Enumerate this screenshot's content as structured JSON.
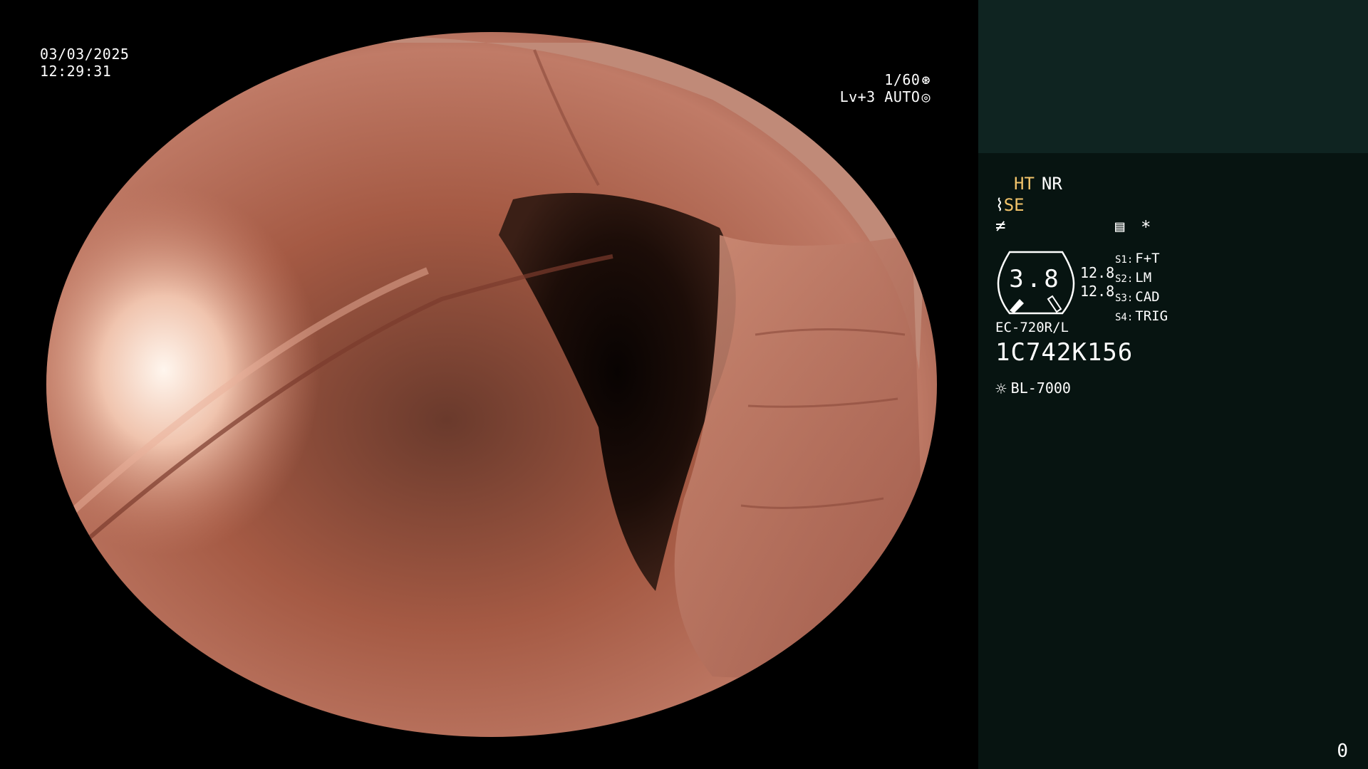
{
  "overlay": {
    "date": "03/03/2025",
    "time": "12:29:31",
    "shutter": "1/60",
    "shutter_icon": "aperture-icon",
    "level": "Lv+3",
    "mode": "AUTO",
    "mode_icon": "auto-target-icon"
  },
  "panel": {
    "modes": {
      "ht": "HT",
      "nr": "NR",
      "se": "SE"
    },
    "gauge_value": "3.8",
    "side_values": [
      "12.8",
      "12.8"
    ],
    "switches": [
      {
        "key": "S1:",
        "label": "F+T"
      },
      {
        "key": "S2:",
        "label": "LM"
      },
      {
        "key": "S3:",
        "label": "CAD"
      },
      {
        "key": "S4:",
        "label": "TRIG"
      }
    ],
    "asterisk": "*",
    "scope_model": "EC-720R/L",
    "scope_serial": "1C742K156",
    "light_source": "BL-7000",
    "counter": "0"
  },
  "colors": {
    "panel_bg": "#071411",
    "panel_top": "#0f2421",
    "highlight": "#f1c36a"
  }
}
